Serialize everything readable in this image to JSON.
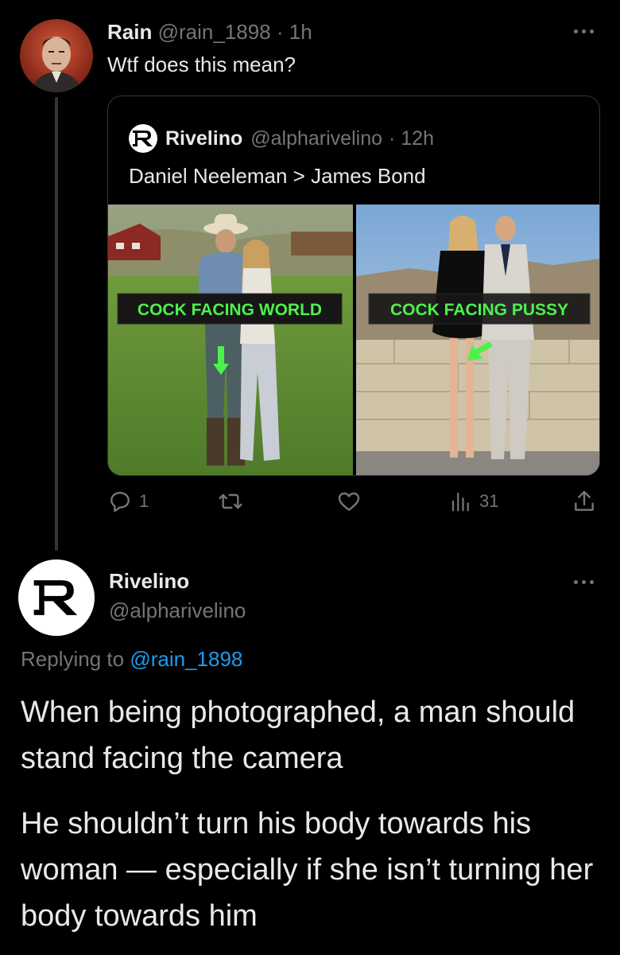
{
  "tweet1": {
    "name": "Rain",
    "handle": "@rain_1898",
    "time": "· 1h",
    "text": "Wtf does this mean?",
    "avatar_icon": "portrait-avatar"
  },
  "quote": {
    "name": "Rivelino",
    "handle": "@alpharivelino",
    "time": "· 12h",
    "avatar_letter": "R",
    "text": "Daniel Neeleman > James Bond",
    "left_caption": "COCK FACING WORLD",
    "right_caption": "COCK FACING PUSSY",
    "caption_color": "#4cf24c"
  },
  "actions": {
    "reply_count": "1",
    "retweet_count": "",
    "like_count": "",
    "views_count": "31",
    "icons": [
      "reply-icon",
      "retweet-icon",
      "like-icon",
      "views-icon",
      "share-icon"
    ]
  },
  "tweet2": {
    "name": "Rivelino",
    "handle": "@alpharivelino",
    "avatar_letter": "R",
    "replying_prefix": "Replying to",
    "replying_handle": "@rain_1898",
    "paragraph1": "When being photographed, a man should stand facing the camera",
    "paragraph2": "He shouldn’t turn his body towards his woman — especially if she isn’t turning her body towards him"
  },
  "colors": {
    "background": "#000000",
    "text": "#e7e9ea",
    "muted": "#71767b",
    "link": "#1d9bf0",
    "border": "#333639"
  }
}
